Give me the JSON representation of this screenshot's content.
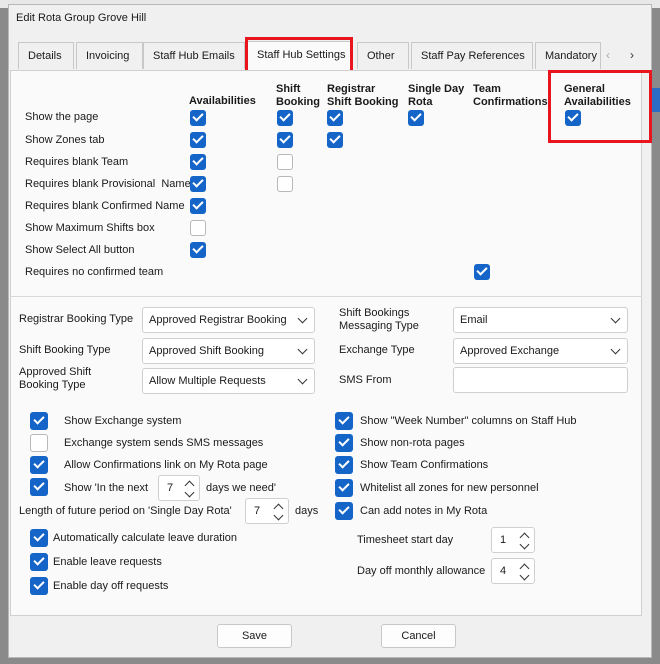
{
  "dialog": {
    "title": "Edit Rota Group Grove Hill"
  },
  "tabs": [
    "Details",
    "Invoicing",
    "Staff Hub Emails",
    "Staff Hub Settings",
    "Other",
    "Staff Pay References",
    "Mandatory"
  ],
  "tab_arrows": {
    "left": "‹",
    "right": "›"
  },
  "columns": [
    {
      "label": "Availabilities"
    },
    {
      "label1": "Shift",
      "label2": "Booking"
    },
    {
      "label1": "Registrar",
      "label2": "Shift Booking"
    },
    {
      "label1": "Single Day",
      "label2": "Rota"
    },
    {
      "label1": "Team",
      "label2": "Confirmations"
    },
    {
      "label1": "General",
      "label2": "Availabilities"
    }
  ],
  "rows": [
    {
      "label": "Show the page",
      "checks": [
        true,
        true,
        true,
        true,
        null,
        true
      ]
    },
    {
      "label": "Show Zones tab",
      "checks": [
        true,
        true,
        true,
        null,
        null,
        null
      ]
    },
    {
      "label": "Requires blank Team",
      "checks": [
        true,
        false,
        null,
        null,
        null,
        null
      ]
    },
    {
      "label": "Requires blank Provisional  Name",
      "checks": [
        true,
        false,
        null,
        null,
        null,
        null
      ]
    },
    {
      "label": "Requires blank Confirmed Name",
      "checks": [
        true,
        null,
        null,
        null,
        null,
        null
      ]
    },
    {
      "label": "Show Maximum Shifts box",
      "checks": [
        false,
        null,
        null,
        null,
        null,
        null
      ]
    },
    {
      "label": "Show Select All button",
      "checks": [
        true,
        null,
        null,
        null,
        null,
        null
      ]
    },
    {
      "label": "Requires no confirmed team",
      "checks": [
        null,
        null,
        null,
        null,
        true,
        null
      ]
    }
  ],
  "fields": {
    "registrar_booking_type": {
      "label": "Registrar Booking Type",
      "value": "Approved Registrar Booking"
    },
    "shift_booking_type": {
      "label": "Shift Booking Type",
      "value": "Approved Shift Booking"
    },
    "approved_shift_booking_type": {
      "label1": "Approved Shift",
      "label2": "Booking Type",
      "value": "Allow Multiple Requests"
    },
    "shift_bookings_messaging_type": {
      "label1": "Shift Bookings",
      "label2": "Messaging Type",
      "value": "Email"
    },
    "exchange_type": {
      "label": "Exchange Type",
      "value": "Approved Exchange"
    },
    "sms_from": {
      "label": "SMS From",
      "value": ""
    }
  },
  "options_left": [
    {
      "label": "Show Exchange system",
      "checked": true
    },
    {
      "label": "Exchange system sends SMS messages",
      "checked": false
    },
    {
      "label": "Allow Confirmations link on My Rota page",
      "checked": true
    },
    {
      "label": "Show 'In the next",
      "checked": true,
      "value": "7",
      "suffix": "days we need'"
    }
  ],
  "future_period": {
    "label": "Length of future period on 'Single Day Rota'",
    "value": "7",
    "suffix": "days"
  },
  "options_left2": [
    {
      "label": "Automatically calculate leave duration",
      "checked": true
    },
    {
      "label": "Enable leave requests",
      "checked": true
    },
    {
      "label": "Enable day off requests",
      "checked": true
    }
  ],
  "options_right": [
    {
      "label": "Show \"Week Number\" columns on Staff Hub",
      "checked": true
    },
    {
      "label": "Show non-rota pages",
      "checked": true
    },
    {
      "label": "Show Team Confirmations",
      "checked": true
    },
    {
      "label": "Whitelist all zones for new personnel",
      "checked": true
    },
    {
      "label": "Can add notes in My Rota",
      "checked": true
    }
  ],
  "timesheet_start_day": {
    "label": "Timesheet start day",
    "value": "1"
  },
  "day_off_allowance": {
    "label": "Day off monthly allowance",
    "value": "4"
  },
  "buttons": {
    "save": "Save",
    "cancel": "Cancel"
  },
  "colors": {
    "accent": "#1565c8",
    "highlight": "#e8141e"
  }
}
